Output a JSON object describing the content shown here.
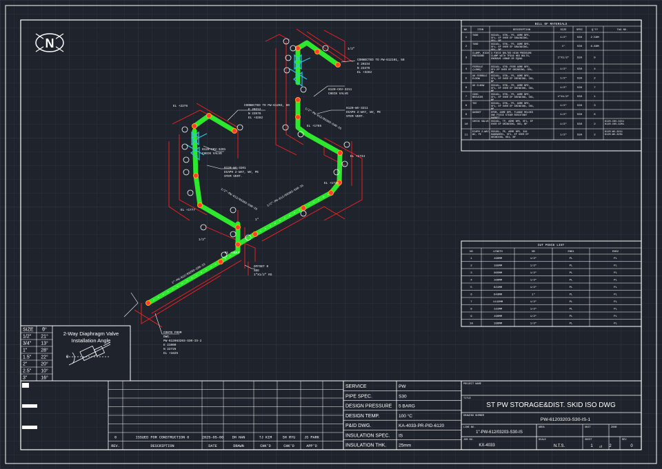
{
  "north_label": "N",
  "diaphragm": {
    "title_line1": "2-Way Diaphragm Valve",
    "title_line2": "Installation Angle",
    "angle_symbol": "θ",
    "header": [
      "SIZE",
      "θ°"
    ],
    "rows": [
      [
        "1/2\"",
        "21°"
      ],
      [
        "3/4\"",
        "13°"
      ],
      [
        "1\"",
        "28°"
      ],
      [
        "1.5\"",
        "22°"
      ],
      [
        "2\"",
        "20°"
      ],
      [
        "2.5\"",
        "10°"
      ],
      [
        "3\"",
        "16°"
      ]
    ]
  },
  "bom": {
    "title": "BILL OF MATERIALS",
    "headers": [
      "NO.",
      "ITEM",
      "DESCRIPTION",
      "SIZE",
      "SPEC",
      "Q'TY",
      "TAG NO."
    ],
    "rows": [
      [
        "1",
        "TUBE",
        "SS316L, STRL, PE, ASME BPE, SF1, EP OVER EP GRAINDING, OD1, BP",
        "1/2\"",
        "S30",
        "2.56M",
        ""
      ],
      [
        "2",
        "TUBE",
        "SS316L, STRL, PE, ASME BPE, SF1, EP OVER EP GRAINDING, OD1, BP",
        "1\"",
        "S30",
        "6.68M",
        ""
      ],
      [
        "3",
        "CLAMP, HIGH PRESSURE",
        "3 PIECE BOLTED HIGH PRESSURE CLAMP WITH TP316 HEX BOLTS, ENGRAVE 10BAR OR EQUAL",
        "1\"X1/2\"",
        "S30",
        "9",
        ""
      ],
      [
        "4",
        "FERRULE (LONG)",
        "SS316L, STRL FERR ASME BPE, SF1 EP OVER EP GRINDING, OD1, BP",
        "1/2\"",
        "S30",
        "4",
        ""
      ],
      [
        "5",
        "90 FERRULE ELBOW",
        "SS316L, STRL, PE, ASME BPE, SF1, EP OVER EP GRINDING, OD1, BP",
        "1/2\"",
        "S30",
        "2",
        ""
      ],
      [
        "6",
        "90 ELBOW",
        "SS316L, STRL, PE, ASME BPE, SF1, EP OVER EP GRINDING, OD1, BP",
        "1/2\"",
        "S30",
        "7",
        ""
      ],
      [
        "7",
        "CONC. REDUCER",
        "SS316L, STRL, PE, ASME BPE, SF1, EP OVER EP GRINDING, OD1, BP",
        "1\"X1/2\"",
        "S30",
        "1",
        ""
      ],
      [
        "8",
        "TEE",
        "SS316L, STRL, PE, ASME BPE, SF1, EP OVER EP GRINDING, OD1, BP",
        "1/2\"",
        "S30",
        "3",
        ""
      ],
      [
        "9",
        "GASKET",
        "EPDM, ASME BPE, FLANGE MOLDED ONE PIECE STEAM RESISTANT GASKET",
        "1/2\"",
        "S30",
        "6",
        ""
      ],
      [
        "10",
        "CHECK VALVE",
        "SS316L, TP, ASME BPE, SF1, EP OVER EP GRINDING, OD1, BP",
        "1/2\"",
        "S30",
        "2",
        "6120-CKV-3211 6120-CKV-3201"
      ],
      [
        "11",
        "DIAPH 2-WAY, WV, PE",
        "SS316L, PE, ASME BPE, 316 HANDWHEEL, SF1, EP OVER EP GRINDING, OD1, BP",
        "1/2\"",
        "S30",
        "2",
        "6120-WV-3211 6120-WV-3201"
      ]
    ]
  },
  "cut_list": {
    "title": "CUT PIECE LIST",
    "headers": [
      "NO",
      "LENGTH",
      "ND",
      "END1",
      "END2"
    ],
    "rows": [
      [
        "1",
        "196MM",
        "1/2\"",
        "PL",
        "PL"
      ],
      [
        "2",
        "185MM",
        "1/2\"",
        "PL",
        "PL"
      ],
      [
        "3",
        "365MM",
        "1/2\"",
        "PL",
        "PL"
      ],
      [
        "4",
        "106MM",
        "1/2\"",
        "PL",
        "PL"
      ],
      [
        "5",
        "621MM",
        "1/2\"",
        "PL",
        "PL"
      ],
      [
        "6",
        "643MM",
        "1\"",
        "PL",
        "PL"
      ],
      [
        "7",
        "1142MM",
        "1/2\"",
        "PL",
        "PL"
      ],
      [
        "8",
        "131MM",
        "1/2\"",
        "PL",
        "PL"
      ],
      [
        "9",
        "196MM",
        "1/2\"",
        "PL",
        "PL"
      ],
      [
        "10",
        "196MM",
        "1/2\"",
        "PL",
        "PL"
      ]
    ]
  },
  "revision": {
    "row": [
      "0",
      "ISSUED FOR CONSTRUCTION 0",
      "2025-05-06",
      "DH HAN",
      "TJ KIM",
      "SH RYU",
      "JS PARK"
    ],
    "headers": [
      "REV.",
      "DESCRIPTION",
      "DATE",
      "DRAWN",
      "CHK'D",
      "CHK'D",
      "APP'D"
    ]
  },
  "service_info": [
    [
      "SERVICE",
      "PW"
    ],
    [
      "PIPE SPEC.",
      "S30"
    ],
    [
      "DESIGN PRESSURE",
      "5 BARG"
    ],
    [
      "DESIGN TEMP.",
      "100 °C"
    ],
    [
      "P&ID DWG.",
      "KA-4033-PR-PID-6120"
    ],
    [
      "INSULATION SPEC.",
      "IS"
    ],
    [
      "INSULATION THK.",
      "25mm"
    ]
  ],
  "title_block": {
    "project_label": "PROJECT NAME",
    "title_label": "TITLE",
    "title": "ST PW STORAGE&DIST. SKID ISO DWG",
    "drawing_number_label": "DRAWING NUMBER",
    "drawing_number": "PW-61203203-S30-IS-1",
    "line_no_label": "LINE NO.",
    "line_no": "1\"-PW-612/03203-S30-IS",
    "area_label": "AREA",
    "unit_label": "UNIT",
    "zone_label": "ZONE",
    "job_no_label": "JOB NO.",
    "job_no": "KX-4033",
    "scale_label": "SCALE",
    "scale": "N.T.S.",
    "sheet_label": "SHEET",
    "sheet": "1",
    "of_label": "of",
    "sheets": "2",
    "rev_label": "REV",
    "rev": "0"
  },
  "iso_labels": {
    "a1": "CONNECTED TO PW-612101, 50",
    "a2": "E 20234",
    "a3": "N 23476",
    "a4": "EL +3282",
    "b1": "CONNECTED TO PW-61202, 80",
    "b2": "E 20212",
    "b3": "N 23576",
    "b4": "EL +3282",
    "c1": "6120-CKV-3211",
    "c2": "CHECK VALVE",
    "d1": "6120-WV-3211",
    "d2": "DIAPH 2-WAY, WV, PE",
    "d3": "STEM VERT.",
    "e1": "6120-CKV-3201",
    "e2": "CHECK VALVE",
    "f1": "6120-WV-3201",
    "f2": "DIAPH 2-WAY, WV, PE",
    "f3": "STEM VERT.",
    "g1": "CONTD FROM",
    "g2": "DWG.",
    "g3": "PW-612063203-S30-IS-2",
    "g4": "E 21000",
    "g5": "N 22725",
    "g6": "EL +1825",
    "h1": "OFFSET 0",
    "h2": "SEE",
    "h3": "1\"X1/2\" RS",
    "el1": "EL +2276",
    "el2": "EL +1765",
    "el3": "EL +1734",
    "el4": "EL +1777",
    "el5": "EL +1725",
    "el6": "EL +1663",
    "size1": "1/2\"",
    "size2": "1/2\"",
    "size3": "1\"",
    "line1": "1\"-PW-612/03203-S30-IS",
    "line2": "1/2\"-PW-612/03203-S30-IS",
    "line3": "1/2\"-PW-612/03203-S30-IS",
    "line4": "1/2\"-PW-612/03203-S30-IS"
  },
  "colors": {
    "background": "#1f232c",
    "grid": "#2c3240",
    "frame": "#ffffff",
    "pipe": "#2ee82e",
    "dimension": "#ff2020",
    "valve": "#29c7e0"
  }
}
